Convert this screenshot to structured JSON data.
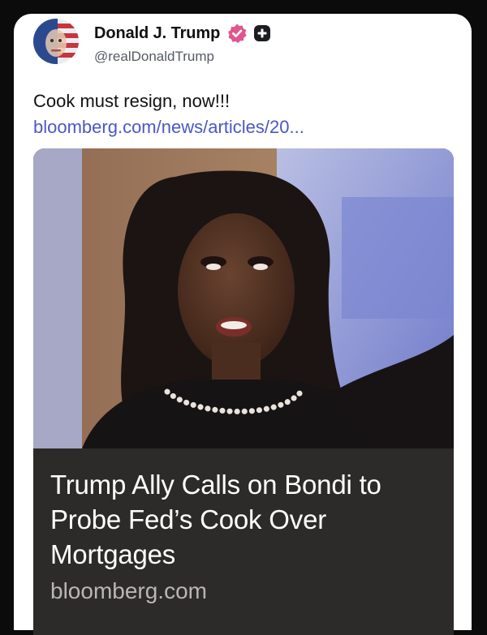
{
  "post": {
    "author": {
      "display_name": "Donald J. Trump",
      "handle": "@realDonaldTrump",
      "verified_icon": "verified-badge-icon",
      "badge_icon": "plus-badge-icon"
    },
    "text": "Cook must resign, now!!!",
    "link_text": "bloomberg.com/news/articles/20...",
    "link_card": {
      "headline": "Trump Ally Calls on Bondi to Probe Fed’s Cook Over Mortgages",
      "domain": "bloomberg.com"
    }
  },
  "colors": {
    "background": "#0b0b0b",
    "card": "#ffffff",
    "link": "#4a57c8",
    "verified_badge": "#e0568f",
    "caption_background": "#2d2b2a"
  }
}
